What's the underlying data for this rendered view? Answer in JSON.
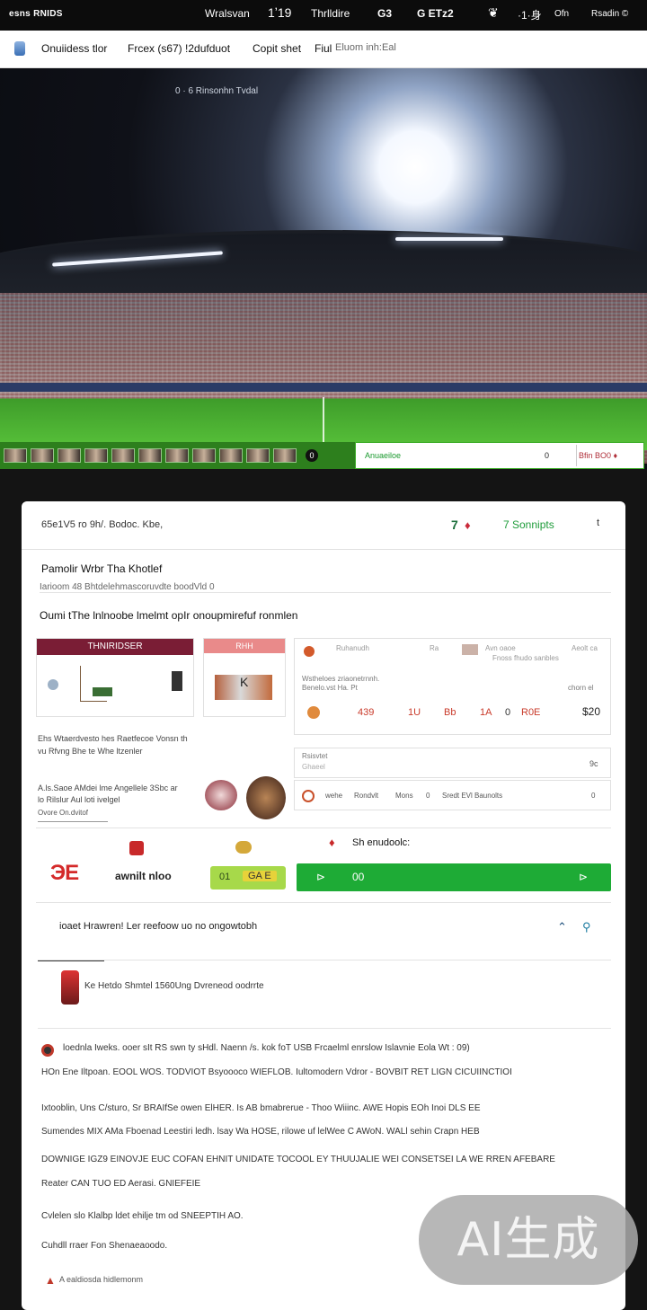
{
  "topbar": {
    "brand": "esns RNIDS",
    "nav": [
      "Wralsvan",
      "1ʼ19",
      "Thrlldire",
      "G3",
      "G ETz2",
      "❦",
      "·1·身",
      "Ofn",
      "Rsadin ©"
    ]
  },
  "secbar": {
    "tabs": [
      "Onuiidess tlor",
      "Frcex (s67) !2dufduot",
      "Copit shet",
      "Fiul",
      "Eluom inh:Eal"
    ]
  },
  "hero": {
    "caption": "0 · 6  Rinsonhn Tvdal",
    "status_left": "Anuaeiloe",
    "status_mid": "0",
    "status_right": "Bfin BO0 ♦"
  },
  "card": {
    "header_left": "65e1V5 ro 9h/. Bodoc. Kbe,",
    "header_count": "7",
    "header_tab": "7 Sonnipts",
    "header_right": "t",
    "section_title": "Pamolir Wrbr Tha Khotlef",
    "section_sub": "Iarioom 48 Bhtdelehmascoruvdte boodVld 0",
    "section_heading": "Oumi tThe lnlnoobe lmelmt opIr onoupmirefuf ronmlen",
    "product1_label": "THNIRIDSER",
    "product2_label": "RHH",
    "product2_letter": "K",
    "panel_row1_a": "Ruhanudh",
    "panel_row1_b": "Ra",
    "panel_row1_c": "Avn oaoe",
    "panel_row1_d": "Fnoss fhudo sanbles",
    "panel_row1_e": "Aeolt ca",
    "panel_row2_a": "Wstheloes zriaonetrnnh.",
    "panel_row2_b": "Benelo.vst Ha. Pt",
    "panel_row2_c": "chorn el",
    "panel_vals": [
      "439",
      "1U",
      "Bb",
      "1A",
      "0",
      "R0E"
    ],
    "panel_price": "$20",
    "desc1_line1": "Ehs Wtaerdvesto hes Raetfecoe Vonsn th",
    "desc1_line2": "vu Rfvng Bhe te Whe ltzenler",
    "desc2_line1": "A.ls.Saoe AMdei lme Angellele 3Sbc ar",
    "desc2_line2": "lo Rilslur Aul loti ivelgel",
    "desc2_link": "Ovore On.dvitof",
    "input_label": "Rsisvtet",
    "input_sub": "Ghaeel",
    "input_val": "9c",
    "mini_row": [
      "wehe",
      "Rondvlt",
      "Mons",
      "0",
      "Sredt EVl Baunolts"
    ],
    "mini_row_end": "0",
    "brand_logo": "ЭE",
    "brand_name": "awnilt nloo",
    "promo_label": "Sh enudoolc:",
    "promo_pill": "GA E",
    "promo_pill_left": "01",
    "cta_left": "⊳",
    "cta_mid": "00",
    "cta_right": "⊳",
    "line_heading": "ioaet Hrawren! Ler reefoow uo no ongowtobh",
    "line_icon1": "⌃",
    "line_icon2": "⚲",
    "item_text": "Ke Hetdo Shmtel 1560Ung Dvreneod oodrrte",
    "para1_a": "loednla Iweks. ooer sIt RS swn ty sHdl.  Naenn /s. kok  foT USB Frcaelml enrslow Islavnie Eola  Wt : 09)",
    "para1_b": "HOn Ene Iltpoan. EOOL WOS. TODVIOT Bsyoooco WIEFLOB. Iultomodern Vdror - BOVBIT  RET LIGN CICUIINCTIOI",
    "para2_a": "Ixtooblin, Uns C/sturo, Sr BRAIfSe owen ElHER.  Is AB bmabrerue - Thoo Wiiinc.  AWE Hopis EOh Inoi DLS EE",
    "para2_b": "Sumendes MIX  AMa Fboenad Leestiri ledh.  lsay Wa HOSE, rilowe uf lelWee C AWoN.  WALl sehin Crapn HEB",
    "para2_c": "DOWNIGE IGZ9 EINOVJE EUC COFAN  EHNIT  UNIDATE  TOCOOL EY  THUUJALIE WEI CONSETSEI LA WE RREN AFEBARE",
    "para2_d": "Reater CAN TUO ED Aerasi.  GNIEFEIE",
    "para3": "Cvlelen slo Klalbp ldet ehilje tm od SNEEPTIH AO.",
    "para4": "Cuhdll rraer Fon Shenaeaoodo.",
    "footer_text": "A ealdiosda hidlemonm",
    "watermark": "AI生成"
  }
}
